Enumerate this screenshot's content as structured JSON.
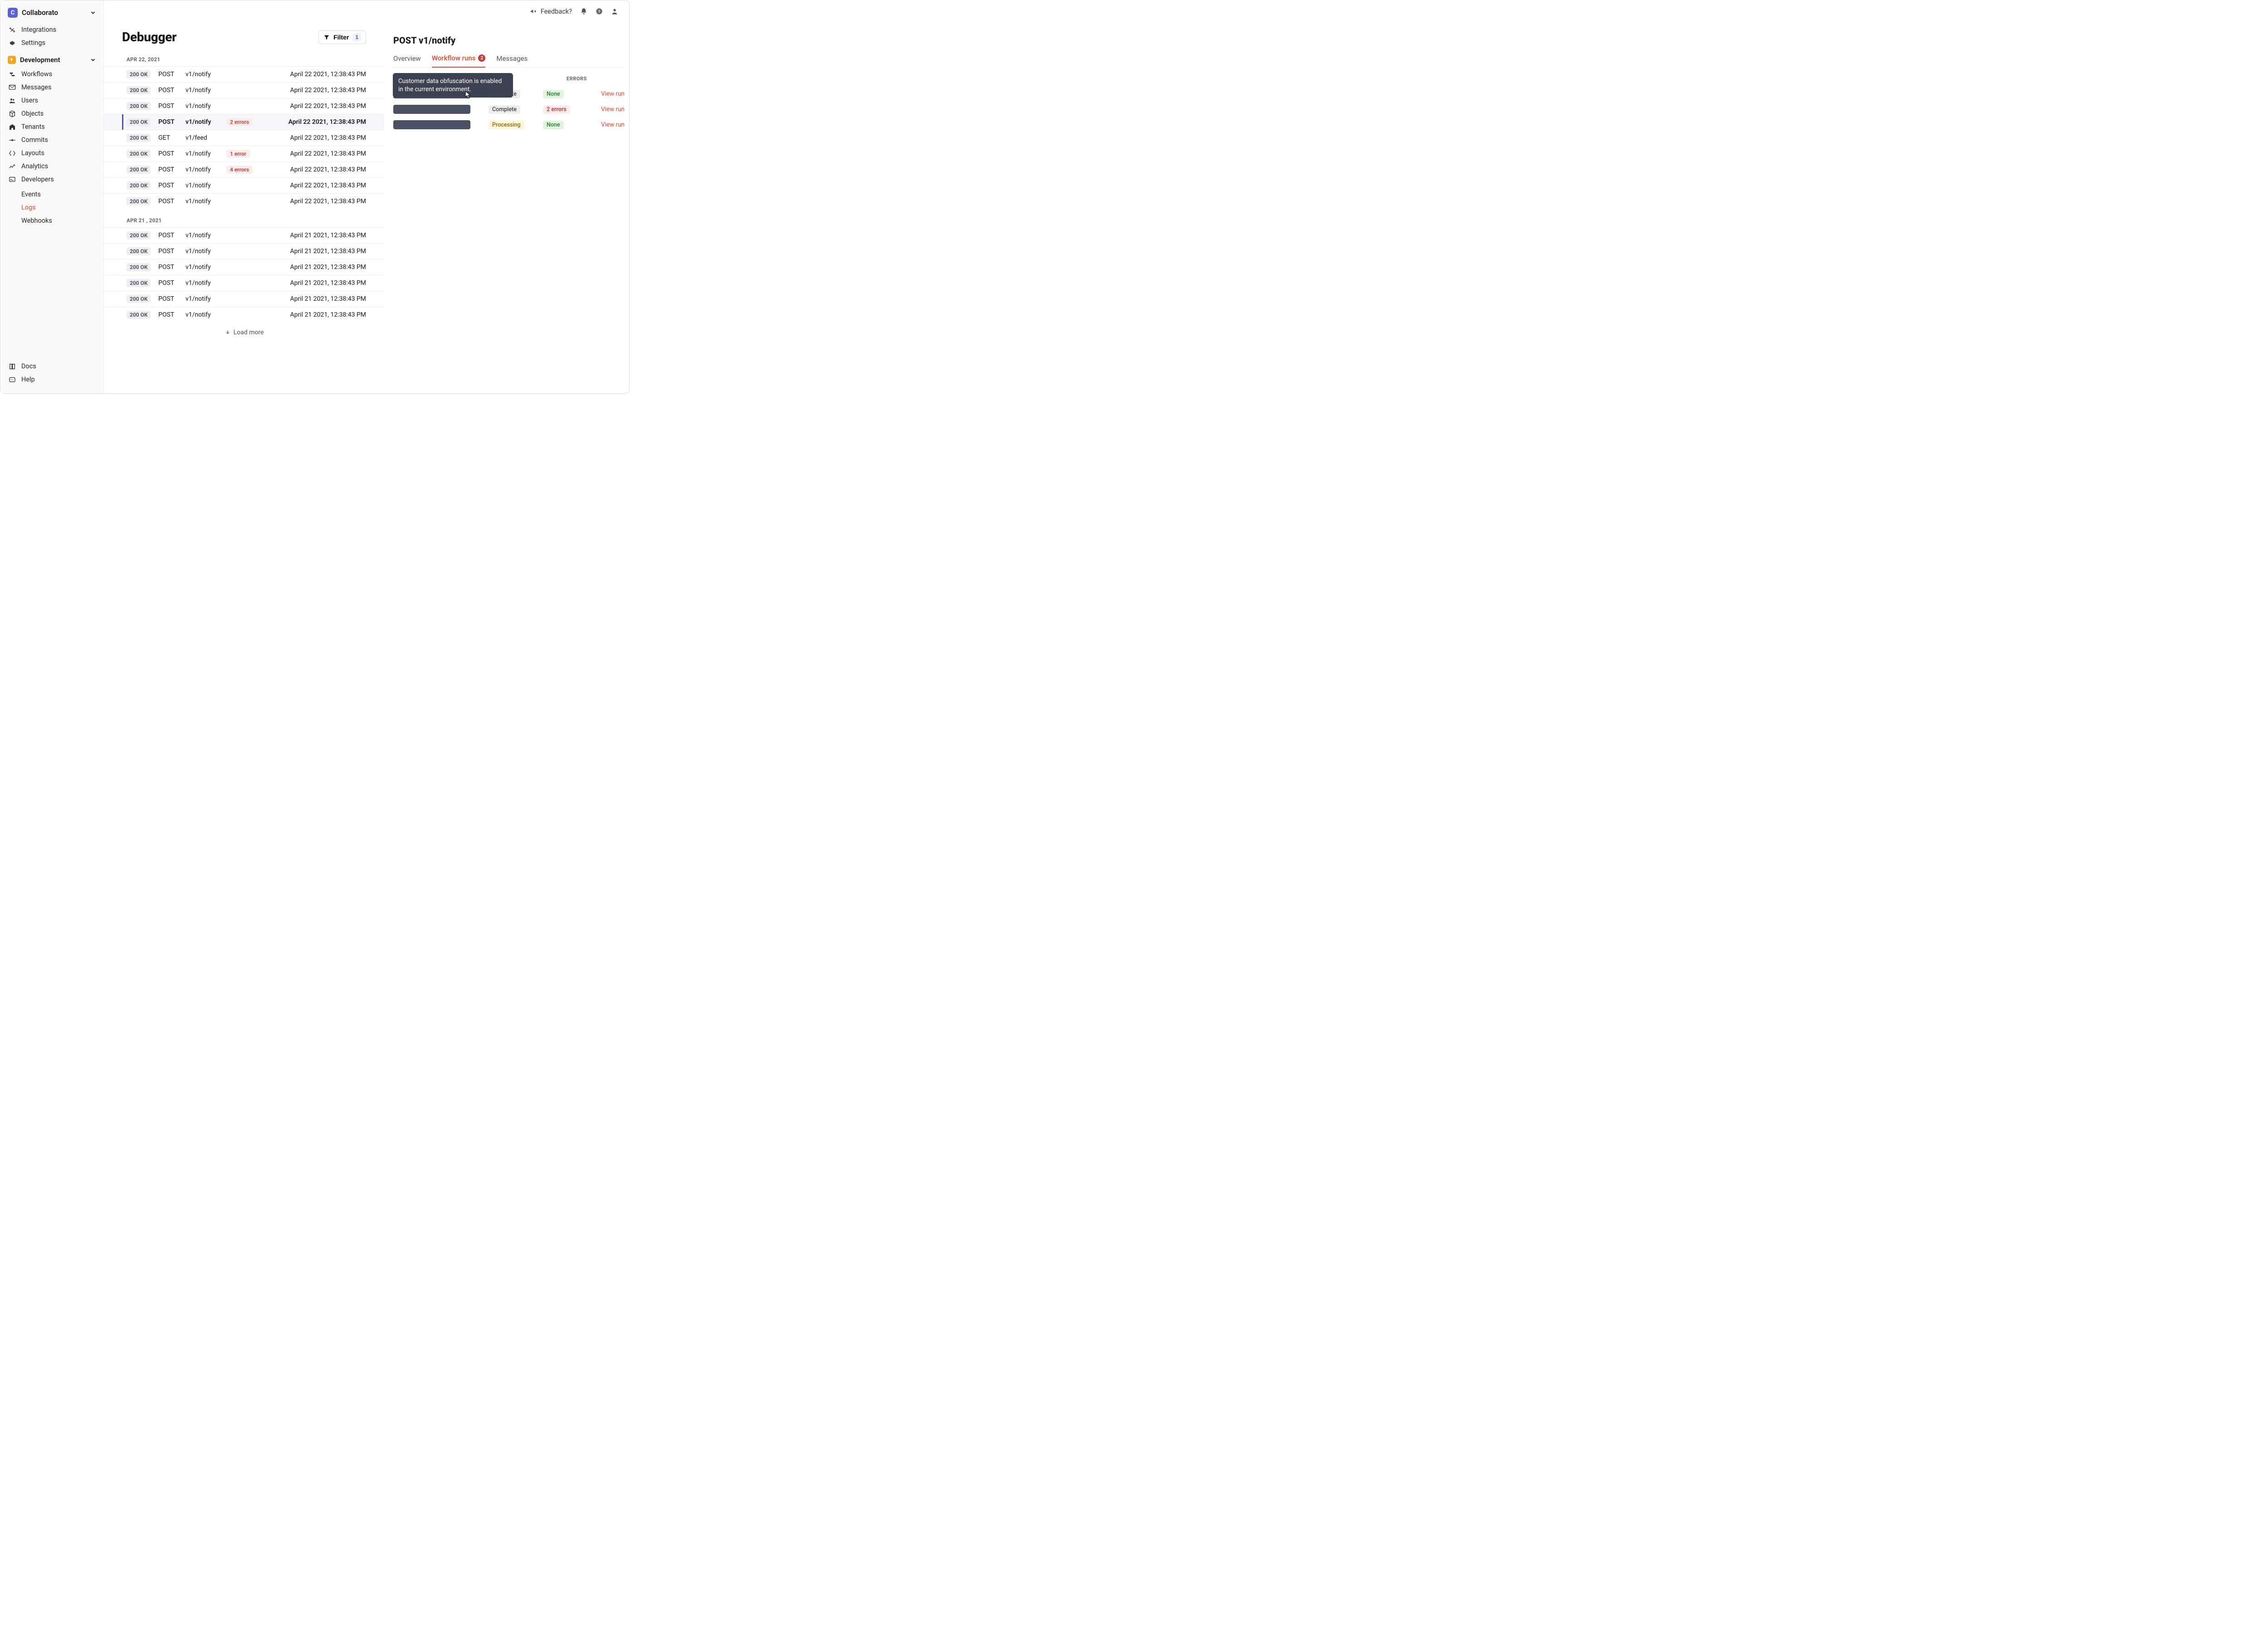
{
  "brand": {
    "name": "Collaborato",
    "initial": "C"
  },
  "topbar": {
    "feedback": "Feedback?"
  },
  "sidebar": {
    "top": [
      {
        "icon": "integrations",
        "label": "Integrations"
      },
      {
        "icon": "settings",
        "label": "Settings"
      }
    ],
    "section_label": "Development",
    "dev": [
      {
        "icon": "workflows",
        "label": "Workflows"
      },
      {
        "icon": "messages",
        "label": "Messages"
      },
      {
        "icon": "users",
        "label": "Users"
      },
      {
        "icon": "objects",
        "label": "Objects"
      },
      {
        "icon": "tenants",
        "label": "Tenants"
      },
      {
        "icon": "commits",
        "label": "Commits"
      },
      {
        "icon": "layouts",
        "label": "Layouts"
      },
      {
        "icon": "analytics",
        "label": "Analytics"
      },
      {
        "icon": "developers",
        "label": "Developers"
      }
    ],
    "devsub": [
      {
        "label": "Events",
        "active": false
      },
      {
        "label": "Logs",
        "active": true
      },
      {
        "label": "Webhooks",
        "active": false
      }
    ],
    "footer": [
      {
        "icon": "docs",
        "label": "Docs"
      },
      {
        "icon": "help",
        "label": "Help"
      }
    ]
  },
  "page": {
    "title": "Debugger",
    "filter_label": "Filter",
    "filter_count": "1",
    "load_more": "Load more"
  },
  "log_groups": [
    {
      "date": "APR 22, 2021",
      "rows": [
        {
          "status": "200 OK",
          "method": "POST",
          "path": "v1/notify",
          "errors": "",
          "time": "April 22 2021, 12:38:43 PM",
          "selected": false
        },
        {
          "status": "200 OK",
          "method": "POST",
          "path": "v1/notify",
          "errors": "",
          "time": "April 22 2021, 12:38:43 PM",
          "selected": false
        },
        {
          "status": "200 OK",
          "method": "POST",
          "path": "v1/notify",
          "errors": "",
          "time": "April 22 2021, 12:38:43 PM",
          "selected": false
        },
        {
          "status": "200 OK",
          "method": "POST",
          "path": "v1/notify",
          "errors": "2 errors",
          "time": "April 22 2021, 12:38:43 PM",
          "selected": true
        },
        {
          "status": "200 OK",
          "method": "GET",
          "path": "v1/feed",
          "errors": "",
          "time": "April 22 2021, 12:38:43 PM",
          "selected": false
        },
        {
          "status": "200 OK",
          "method": "POST",
          "path": "v1/notify",
          "errors": "1 error",
          "time": "April 22 2021, 12:38:43 PM",
          "selected": false
        },
        {
          "status": "200 OK",
          "method": "POST",
          "path": "v1/notify",
          "errors": "4 errors",
          "time": "April 22 2021, 12:38:43 PM",
          "selected": false
        },
        {
          "status": "200 OK",
          "method": "POST",
          "path": "v1/notify",
          "errors": "",
          "time": "April 22 2021, 12:38:43 PM",
          "selected": false
        },
        {
          "status": "200 OK",
          "method": "POST",
          "path": "v1/notify",
          "errors": "",
          "time": "April 22 2021, 12:38:43 PM",
          "selected": false
        }
      ]
    },
    {
      "date": "APR 21 , 2021",
      "rows": [
        {
          "status": "200 OK",
          "method": "POST",
          "path": "v1/notify",
          "errors": "",
          "time": "April 21 2021, 12:38:43 PM",
          "selected": false
        },
        {
          "status": "200 OK",
          "method": "POST",
          "path": "v1/notify",
          "errors": "",
          "time": "April 21 2021, 12:38:43 PM",
          "selected": false
        },
        {
          "status": "200 OK",
          "method": "POST",
          "path": "v1/notify",
          "errors": "",
          "time": "April 21 2021, 12:38:43 PM",
          "selected": false
        },
        {
          "status": "200 OK",
          "method": "POST",
          "path": "v1/notify",
          "errors": "",
          "time": "April 21 2021, 12:38:43 PM",
          "selected": false
        },
        {
          "status": "200 OK",
          "method": "POST",
          "path": "v1/notify",
          "errors": "",
          "time": "April 21 2021, 12:38:43 PM",
          "selected": false
        },
        {
          "status": "200 OK",
          "method": "POST",
          "path": "v1/notify",
          "errors": "",
          "time": "April 21 2021, 12:38:43 PM",
          "selected": false
        }
      ]
    }
  ],
  "detail": {
    "title": "POST v1/notify",
    "tabs": {
      "overview": "Overview",
      "workflow_runs": "Workflow runs",
      "workflow_runs_badge": "2",
      "messages": "Messages"
    },
    "tooltip": "Customer data obfuscation is enabled in the current environment.",
    "table": {
      "head_errors": "ERRORS",
      "rows": [
        {
          "status": "Complete",
          "status_kind": "complete",
          "errors": "None",
          "errors_kind": "none",
          "action": "View run"
        },
        {
          "status": "Complete",
          "status_kind": "complete",
          "errors": "2 errors",
          "errors_kind": "errs",
          "action": "View run"
        },
        {
          "status": "Processing",
          "status_kind": "processing",
          "errors": "None",
          "errors_kind": "none",
          "action": "View run"
        }
      ]
    }
  }
}
